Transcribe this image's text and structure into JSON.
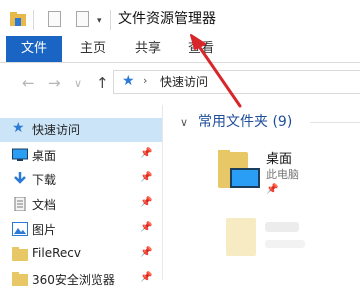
{
  "window": {
    "title": "文件资源管理器",
    "quick_access_dropdown": "▾"
  },
  "ribbon": {
    "tabs": [
      {
        "label": "文件"
      },
      {
        "label": "主页"
      },
      {
        "label": "共享"
      },
      {
        "label": "查看"
      }
    ]
  },
  "address_bar": {
    "back": "←",
    "forward": "→",
    "recent": "∨",
    "up": "↑",
    "separator": "›",
    "location": "快速访问"
  },
  "nav_pane": {
    "items": [
      {
        "label": "快速访问",
        "icon": "star-icon",
        "pinned": false,
        "selected": true
      },
      {
        "label": "桌面",
        "icon": "desktop-icon",
        "pinned": true
      },
      {
        "label": "下载",
        "icon": "download-icon",
        "pinned": true
      },
      {
        "label": "文档",
        "icon": "document-icon",
        "pinned": true
      },
      {
        "label": "图片",
        "icon": "picture-icon",
        "pinned": true
      },
      {
        "label": "FileRecv",
        "icon": "folder-icon",
        "pinned": true
      },
      {
        "label": "360安全浏览器",
        "icon": "folder-icon",
        "pinned": true
      }
    ],
    "pin_glyph": "📌"
  },
  "content": {
    "group_title": "常用文件夹 (9)",
    "items": [
      {
        "name": "桌面",
        "location": "此电脑",
        "pin": "📌"
      }
    ]
  },
  "colors": {
    "accent": "#1a64c4",
    "selected": "#cce4f7",
    "annotation_arrow": "#d8262b"
  }
}
